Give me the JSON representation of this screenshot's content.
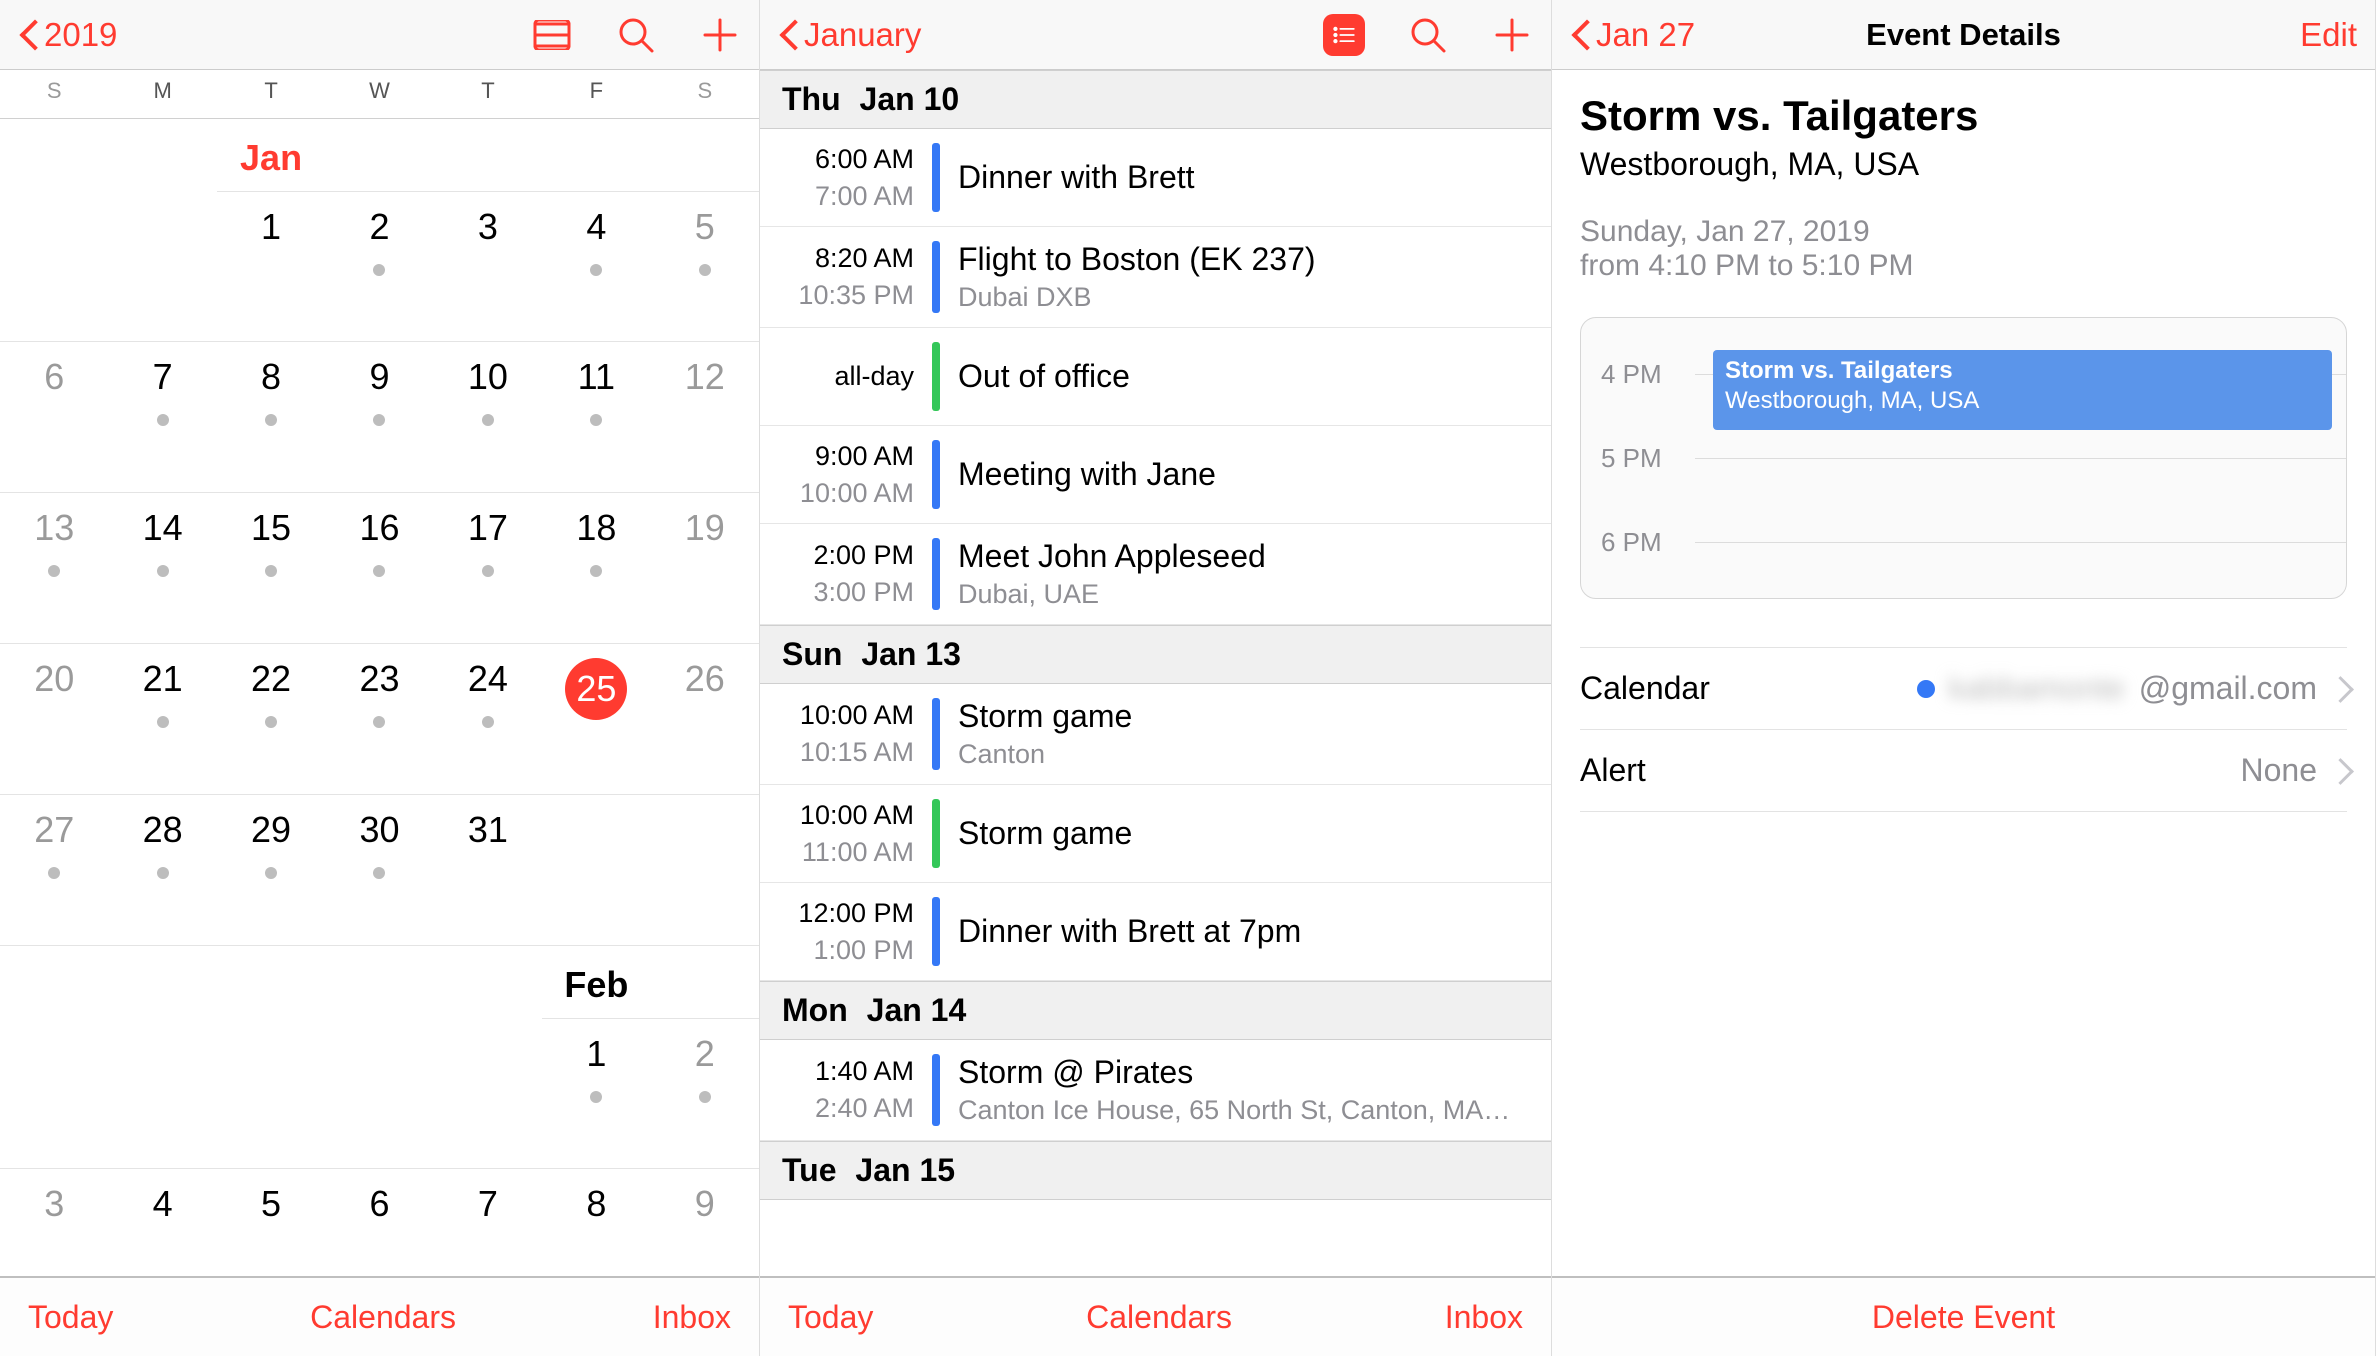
{
  "colors": {
    "accent": "#ff3b30",
    "blue": "#3478f6",
    "green": "#34c759"
  },
  "panel1": {
    "back_label": "2019",
    "weekdays": [
      "S",
      "M",
      "T",
      "W",
      "T",
      "F",
      "S"
    ],
    "month1": {
      "label": "Jan",
      "label_col": 2,
      "rows": [
        {
          "cells": [
            null,
            null,
            {
              "n": 1
            },
            {
              "n": 2,
              "dot": true
            },
            {
              "n": 3
            },
            {
              "n": 4,
              "dot": true
            },
            {
              "n": 5,
              "dot": true,
              "wk": true
            }
          ]
        },
        {
          "cells": [
            {
              "n": 6,
              "wk": true
            },
            {
              "n": 7,
              "dot": true
            },
            {
              "n": 8,
              "dot": true
            },
            {
              "n": 9,
              "dot": true
            },
            {
              "n": 10,
              "dot": true
            },
            {
              "n": 11,
              "dot": true
            },
            {
              "n": 12,
              "wk": true
            }
          ]
        },
        {
          "cells": [
            {
              "n": 13,
              "dot": true,
              "wk": true
            },
            {
              "n": 14,
              "dot": true
            },
            {
              "n": 15,
              "dot": true
            },
            {
              "n": 16,
              "dot": true
            },
            {
              "n": 17,
              "dot": true
            },
            {
              "n": 18,
              "dot": true
            },
            {
              "n": 19,
              "wk": true
            }
          ]
        },
        {
          "cells": [
            {
              "n": 20,
              "wk": true
            },
            {
              "n": 21,
              "dot": true
            },
            {
              "n": 22,
              "dot": true
            },
            {
              "n": 23,
              "dot": true
            },
            {
              "n": 24,
              "dot": true
            },
            {
              "n": 25,
              "today": true
            },
            {
              "n": 26,
              "wk": true
            }
          ]
        },
        {
          "cells": [
            {
              "n": 27,
              "dot": true,
              "wk": true
            },
            {
              "n": 28,
              "dot": true
            },
            {
              "n": 29,
              "dot": true
            },
            {
              "n": 30,
              "dot": true
            },
            {
              "n": 31
            },
            null,
            null
          ]
        }
      ]
    },
    "month2": {
      "label": "Feb",
      "label_col": 5,
      "rows": [
        {
          "cells": [
            null,
            null,
            null,
            null,
            null,
            {
              "n": 1,
              "dot": true
            },
            {
              "n": 2,
              "dot": true,
              "wk": true
            }
          ]
        },
        {
          "cells": [
            {
              "n": 3,
              "wk": true
            },
            {
              "n": 4
            },
            {
              "n": 5
            },
            {
              "n": 6
            },
            {
              "n": 7
            },
            {
              "n": 8
            },
            {
              "n": 9,
              "wk": true
            }
          ]
        }
      ]
    },
    "toolbar": {
      "today": "Today",
      "calendars": "Calendars",
      "inbox": "Inbox"
    }
  },
  "panel2": {
    "back_label": "January",
    "sections": [
      {
        "dow": "Thu",
        "date": "Jan 10",
        "events": [
          {
            "t1": "6:00 AM",
            "t2": "7:00 AM",
            "color": "blue",
            "title": "Dinner with Brett"
          },
          {
            "t1": "8:20 AM",
            "t2": "10:35 PM",
            "color": "blue",
            "title": "Flight to Boston (EK 237)",
            "sub": "Dubai DXB"
          },
          {
            "t1": "all-day",
            "t2": "",
            "color": "green",
            "title": "Out of office"
          },
          {
            "t1": "9:00 AM",
            "t2": "10:00 AM",
            "color": "blue",
            "title": "Meeting with Jane"
          },
          {
            "t1": "2:00 PM",
            "t2": "3:00 PM",
            "color": "blue",
            "title": "Meet John Appleseed",
            "sub": "Dubai, UAE"
          }
        ]
      },
      {
        "dow": "Sun",
        "date": "Jan 13",
        "events": [
          {
            "t1": "10:00 AM",
            "t2": "10:15 AM",
            "color": "blue",
            "title": "Storm game",
            "sub": "Canton"
          },
          {
            "t1": "10:00 AM",
            "t2": "11:00 AM",
            "color": "green",
            "title": "Storm game"
          },
          {
            "t1": "12:00 PM",
            "t2": "1:00 PM",
            "color": "blue",
            "title": "Dinner with Brett at 7pm"
          }
        ]
      },
      {
        "dow": "Mon",
        "date": "Jan 14",
        "events": [
          {
            "t1": "1:40 AM",
            "t2": "2:40 AM",
            "color": "blue",
            "title": "Storm @ Pirates",
            "sub": "Canton Ice House, 65 North St, Canton, MA…"
          }
        ]
      },
      {
        "dow": "Tue",
        "date": "Jan 15",
        "events": []
      }
    ],
    "toolbar": {
      "today": "Today",
      "calendars": "Calendars",
      "inbox": "Inbox"
    }
  },
  "panel3": {
    "back_label": "Jan 27",
    "nav_title": "Event Details",
    "edit_label": "Edit",
    "event": {
      "title": "Storm vs. Tailgaters",
      "location": "Westborough, MA, USA",
      "date_line": "Sunday, Jan 27, 2019",
      "time_line": "from 4:10 PM to 5:10 PM"
    },
    "timeline": {
      "hours": [
        "4 PM",
        "5 PM",
        "6 PM"
      ],
      "block": {
        "title": "Storm vs. Tailgaters",
        "sub": "Westborough, MA, USA"
      }
    },
    "settings": {
      "calendar_label": "Calendar",
      "calendar_value_suffix": "@gmail.com",
      "calendar_blurred": "kabbamonte",
      "alert_label": "Alert",
      "alert_value": "None"
    },
    "delete_label": "Delete Event"
  }
}
